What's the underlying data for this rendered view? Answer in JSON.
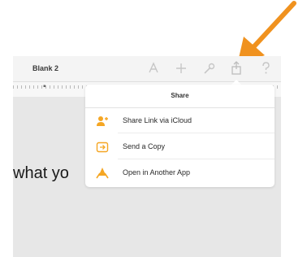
{
  "toolbar": {
    "document_title": "Blank 2"
  },
  "document": {
    "visible_text": "what yo"
  },
  "share_popover": {
    "title": "Share",
    "items": [
      {
        "label": "Share Link via iCloud",
        "icon": "person-share-icon"
      },
      {
        "label": "Send a Copy",
        "icon": "send-copy-icon"
      },
      {
        "label": "Open in Another App",
        "icon": "open-app-icon"
      }
    ]
  },
  "colors": {
    "accent_orange": "#f5a623",
    "callout_arrow": "#f0921f",
    "toolbar_icon": "#c6c6c6"
  }
}
